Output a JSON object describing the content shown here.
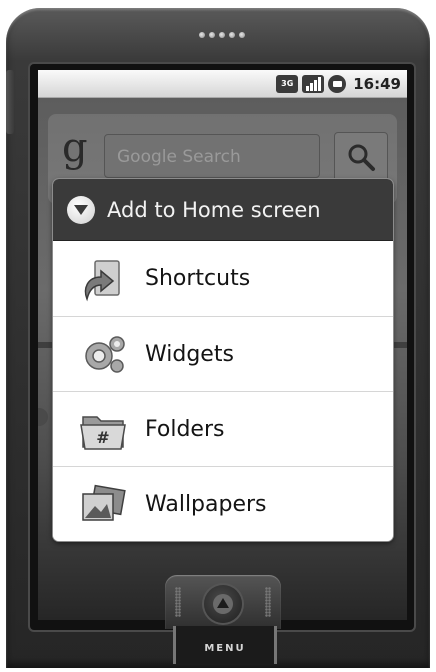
{
  "status_bar": {
    "network_label": "3G",
    "time": "16:49",
    "icons": [
      "network-3g-icon",
      "signal-strength-icon",
      "battery-icon"
    ]
  },
  "home_screen": {
    "google_logo": "g",
    "search_placeholder": "Google Search",
    "search_button_icon": "search-icon"
  },
  "dialog": {
    "title": "Add to Home screen",
    "title_icon": "add-icon",
    "items": [
      {
        "label": "Shortcuts",
        "icon": "shortcuts-icon"
      },
      {
        "label": "Widgets",
        "icon": "widgets-icon"
      },
      {
        "label": "Folders",
        "icon": "folders-icon"
      },
      {
        "label": "Wallpapers",
        "icon": "wallpapers-icon"
      }
    ]
  },
  "hardware": {
    "menu_key": "MENU",
    "home_button_icon": "home-button-icon"
  }
}
